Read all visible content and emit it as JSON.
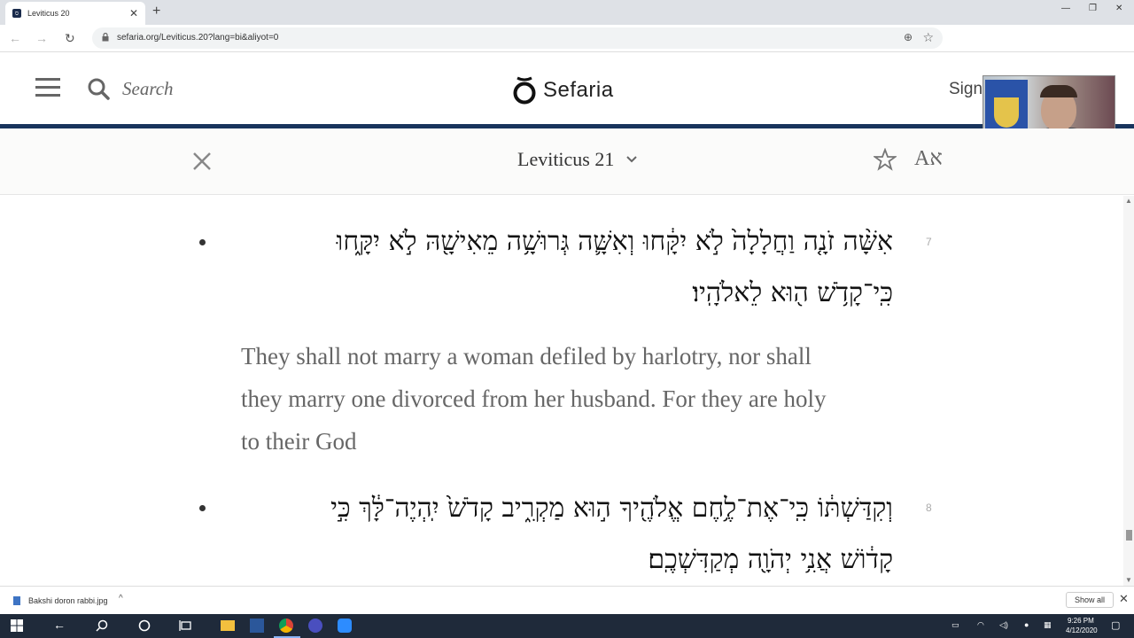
{
  "browser": {
    "tab_title": "Leviticus 20",
    "favicon_glyph": "ס",
    "url": "sefaria.org/Leviticus.20?lang=bi&aliyot=0"
  },
  "header": {
    "search_label": "Search",
    "logo_text": "Sefaria",
    "signin_label": "Sign"
  },
  "reader": {
    "ref_title": "Leviticus 21"
  },
  "verses": [
    {
      "number": "7",
      "hebrew_line1": "אִשָּׁ֨ה זֹנָ֤ה וַחֲלָלָה֙ לֹ֣א יִקָּ֔חוּ וְאִשָּׁ֛ה גְּרוּשָׁ֥ה מֵאִישָׁ֖הּ לֹ֣א יִקָּ֑חוּ",
      "hebrew_line2": "כִּֽי־קָדֹ֥שׁ ה֖וּא לֵאלֹהָֽיו׃",
      "english_line1": "They shall not marry a woman defiled by harlotry, nor shall",
      "english_line2": "they marry one divorced from her husband. For they are holy",
      "english_line3": "to their God"
    },
    {
      "number": "8",
      "hebrew_line1": "וְקִדַּשְׁתּ֔וֹ כִּֽי־אֶת־לֶ֥חֶם אֱלֹהֶ֖יךָ ה֣וּא מַקְרִ֑יב קָדֹשׁ֙ יִֽהְיֶה־לָּ֔ךְ כִּ֣י",
      "hebrew_line2": "קָד֔וֹשׁ אֲנִ֥י יְהֹוָ֖ה מְקַדִּשְׁכֶֽם׃"
    }
  ],
  "downloads": {
    "file_name": "Bakshi doron rabbi.jpg",
    "show_all_label": "Show all"
  },
  "taskbar": {
    "time": "9:26 PM",
    "date": "4/12/2020"
  },
  "colors": {
    "header_rule": "#18345d",
    "taskbar": "#1f2a3a"
  }
}
